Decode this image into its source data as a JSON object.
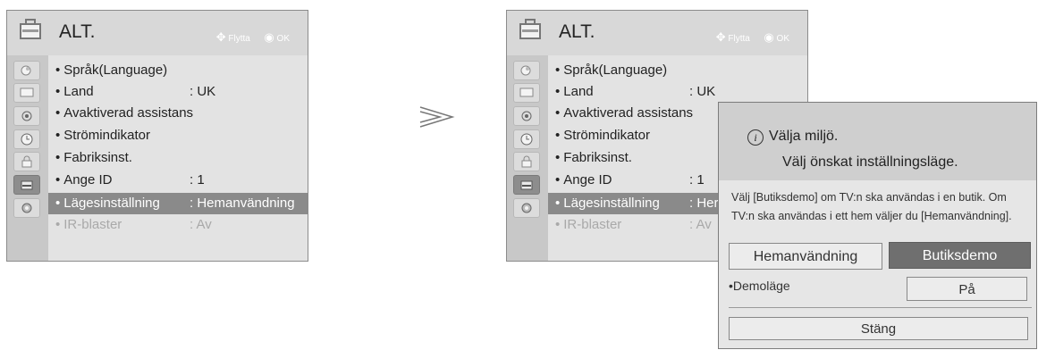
{
  "menu": {
    "title": "ALT.",
    "hint_move": "Flytta",
    "hint_ok": "OK",
    "items": [
      {
        "label": "Språk(Language)",
        "value": ""
      },
      {
        "label": "Land",
        "value": ": UK"
      },
      {
        "label": "Avaktiverad assistans",
        "value": ""
      },
      {
        "label": "Strömindikator",
        "value": ""
      },
      {
        "label": "Fabriksinst.",
        "value": ""
      },
      {
        "label": "Ange ID",
        "value": ": 1"
      },
      {
        "label": "Lägesinställning",
        "value": ": Hemanvändning"
      },
      {
        "label": "IR-blaster",
        "value": ": Av"
      }
    ],
    "items_right": [
      {
        "label": "Språk(Language)",
        "value": ""
      },
      {
        "label": "Land",
        "value": ": UK"
      },
      {
        "label": "Avaktiverad assistans",
        "value": ""
      },
      {
        "label": "Strömindikator",
        "value": ""
      },
      {
        "label": "Fabriksinst.",
        "value": ""
      },
      {
        "label": "Ange ID",
        "value": ": 1"
      },
      {
        "label": "Lägesinställning",
        "value": ": Her"
      },
      {
        "label": "IR-blaster",
        "value": ": Av"
      }
    ]
  },
  "popup": {
    "title": "Välja miljö.",
    "subtitle": "Välj önskat inställningsläge.",
    "description": "Välj [Butiksdemo] om TV:n ska användas i en butik. Om TV:n ska användas i ett hem väljer du [Hemanvändning].",
    "option_home": "Hemanvändning",
    "option_store": "Butiksdemo",
    "demo_label": "Demoläge",
    "demo_value": "På",
    "close_label": "Stäng"
  },
  "colors": {
    "selected_row": "#8a8a8a",
    "active_button": "#6f6f6f"
  }
}
